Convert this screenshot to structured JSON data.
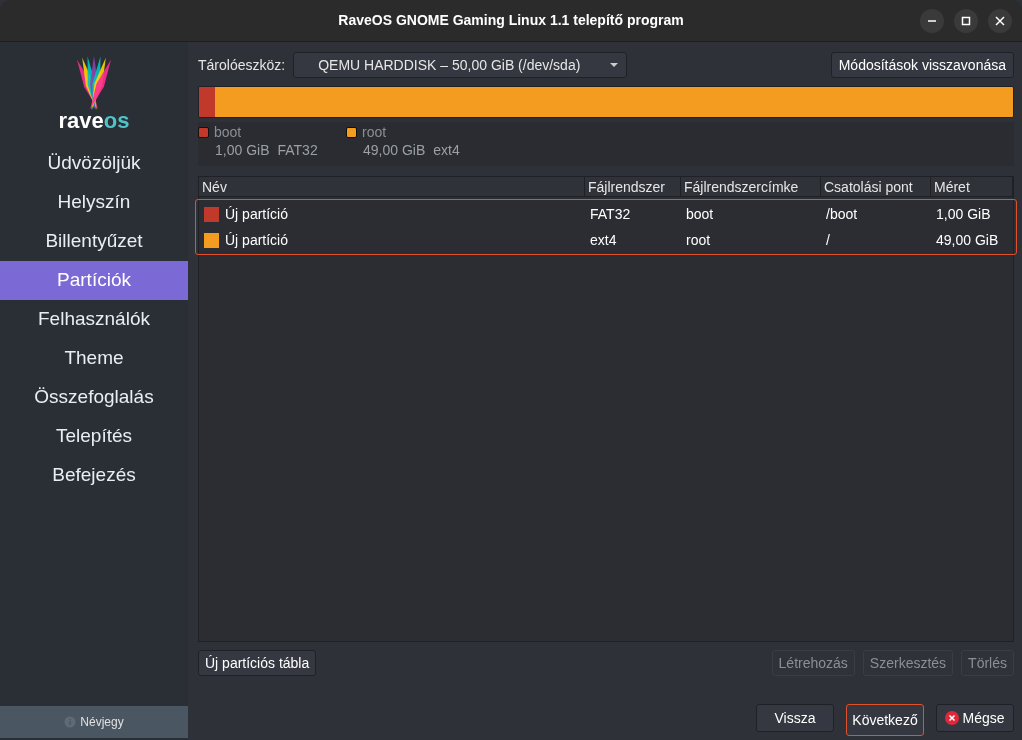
{
  "window": {
    "title": "RaveOS GNOME Gaming Linux 1.1 telepítő program"
  },
  "logo": {
    "word_1": "rave",
    "word_2": "os"
  },
  "sidebar": {
    "items": [
      {
        "label": "Üdvözöljük",
        "selected": false
      },
      {
        "label": "Helyszín",
        "selected": false
      },
      {
        "label": "Billentyűzet",
        "selected": false
      },
      {
        "label": "Partíciók",
        "selected": true
      },
      {
        "label": "Felhasználók",
        "selected": false
      },
      {
        "label": "Theme",
        "selected": false
      },
      {
        "label": "Összefoglalás",
        "selected": false
      },
      {
        "label": "Telepítés",
        "selected": false
      },
      {
        "label": "Befejezés",
        "selected": false
      }
    ],
    "about_button": "Névjegy"
  },
  "storage": {
    "label": "Tárolóeszköz:",
    "device": "QEMU HARDDISK – 50,00 GiB (/dev/sda)",
    "revert_button": "Módosítások visszavonása"
  },
  "partitions_bar": [
    {
      "name": "boot",
      "size": "1,00 GiB",
      "fs": "FAT32",
      "color": "#c0392b",
      "level": 0.02
    },
    {
      "name": "root",
      "size": "49,00 GiB",
      "fs": "ext4",
      "color": "#f39c1f",
      "level": 0.98
    }
  ],
  "table": {
    "columns": [
      "Név",
      "Fájlrendszer",
      "Fájlrendszercímke",
      "Csatolási pont",
      "Méret"
    ],
    "rows": [
      {
        "color": "#c0392b",
        "cells": [
          "Új partíció",
          "FAT32",
          "boot",
          "/boot",
          "1,00 GiB"
        ]
      },
      {
        "color": "#f39c1f",
        "cells": [
          "Új partíció",
          "ext4",
          "root",
          "/",
          "49,00 GiB"
        ]
      }
    ]
  },
  "table_buttons": [
    {
      "label": "Új partíciós tábla",
      "disabled": false
    },
    {
      "label": "Létrehozás",
      "disabled": true
    },
    {
      "label": "Szerkesztés",
      "disabled": true
    },
    {
      "label": "Törlés",
      "disabled": true
    }
  ],
  "footer_buttons": [
    {
      "label": "Vissza",
      "kind": "plain",
      "focused": false
    },
    {
      "label": "Következő",
      "kind": "plain",
      "focused": true
    },
    {
      "label": "Mégse",
      "kind": "cancel",
      "focused": false
    }
  ]
}
